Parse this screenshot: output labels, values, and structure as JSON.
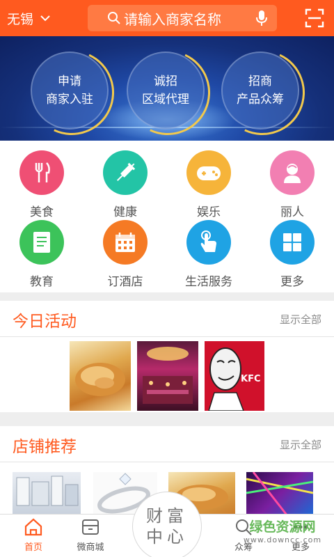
{
  "header": {
    "city": "无锡",
    "search_placeholder": "请输入商家名称"
  },
  "banner": {
    "items": [
      {
        "line1": "申请",
        "line2": "商家入驻"
      },
      {
        "line1": "诚招",
        "line2": "区域代理"
      },
      {
        "line1": "招商",
        "line2": "产品众筹"
      }
    ]
  },
  "categories": [
    {
      "label": "美食",
      "icon": "utensils-icon",
      "color": "#ef4f74"
    },
    {
      "label": "健康",
      "icon": "syringe-icon",
      "color": "#23c4a6"
    },
    {
      "label": "娱乐",
      "icon": "gamepad-icon",
      "color": "#f6b43a"
    },
    {
      "label": "丽人",
      "icon": "woman-icon",
      "color": "#f27fb2"
    },
    {
      "label": "教育",
      "icon": "book-icon",
      "color": "#3cc35a"
    },
    {
      "label": "订酒店",
      "icon": "calendar-icon",
      "color": "#f57a24"
    },
    {
      "label": "生活服务",
      "icon": "hand-pointer-icon",
      "color": "#1fa3e4"
    },
    {
      "label": "更多",
      "icon": "grid-icon",
      "color": "#1fa3e4"
    }
  ],
  "today": {
    "title": "今日活动",
    "more": "显示全部"
  },
  "shops": {
    "title": "店铺推荐",
    "more": "显示全部"
  },
  "tabs": [
    {
      "label": "首页",
      "icon": "home-icon"
    },
    {
      "label": "微商城",
      "icon": "store-icon"
    },
    {
      "label": "众筹",
      "icon": "crowdfund-icon"
    },
    {
      "label": "更多",
      "icon": "more-icon"
    }
  ],
  "center_button": {
    "line1": "财富",
    "line2": "中心"
  },
  "watermark": {
    "line1": "绿色资源网",
    "line2": "www.downcc.com"
  },
  "colors": {
    "accent": "#ff5a1f",
    "kfc_red": "#d0112b"
  }
}
